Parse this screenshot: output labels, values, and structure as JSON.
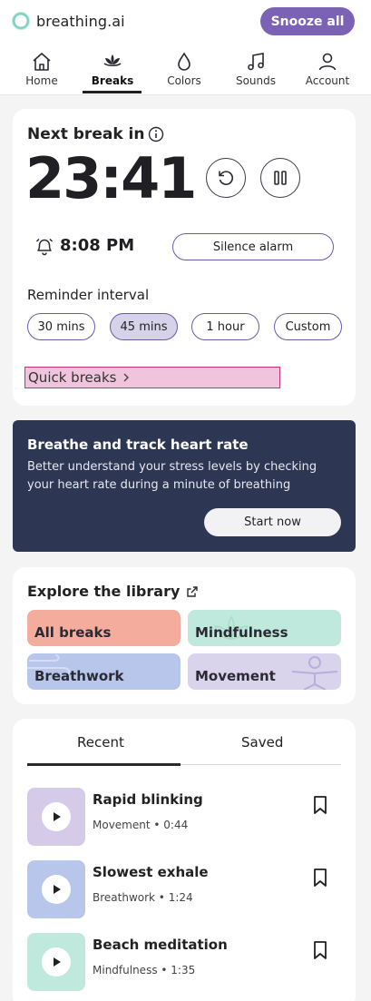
{
  "header": {
    "brand_name": "breathing.ai",
    "snooze_label": "Snooze all",
    "accent_color": "#7b62b5"
  },
  "nav": {
    "items": [
      {
        "label": "Home",
        "icon": "home-icon"
      },
      {
        "label": "Breaks",
        "icon": "lotus-icon",
        "active": true
      },
      {
        "label": "Colors",
        "icon": "drop-icon"
      },
      {
        "label": "Sounds",
        "icon": "music-note-icon"
      },
      {
        "label": "Account",
        "icon": "user-icon"
      }
    ]
  },
  "break_card": {
    "title": "Next break in",
    "timer": "23:41",
    "alarm_time": "8:08 PM",
    "silence_label": "Silence alarm",
    "interval_title": "Reminder interval",
    "intervals": [
      "30 mins",
      "45 mins",
      "1 hour",
      "Custom"
    ],
    "selected_interval": "45 mins",
    "quick_breaks_label": "Quick breaks"
  },
  "heart_card": {
    "title": "Breathe and track heart rate",
    "description": "Better understand your stress levels by checking your heart rate during a minute of breathing",
    "start_label": "Start now",
    "bg_color": "#2d3753"
  },
  "library": {
    "title": "Explore the library",
    "tiles": [
      {
        "label": "All breaks",
        "color": "#f4ad9d"
      },
      {
        "label": "Mindfulness",
        "color": "#bfe9dc"
      },
      {
        "label": "Breathwork",
        "color": "#b7c6ea"
      },
      {
        "label": "Movement",
        "color": "#d9d4ec"
      }
    ]
  },
  "recent": {
    "tabs": [
      "Recent",
      "Saved"
    ],
    "active_tab": "Recent",
    "items": [
      {
        "title": "Rapid blinking",
        "category": "Movement",
        "duration": "0:44",
        "subtitle": "Movement • 0:44",
        "color": "#d5cbe8"
      },
      {
        "title": "Slowest exhale",
        "category": "Breathwork",
        "duration": "1:24",
        "subtitle": "Breathwork • 1:24",
        "color": "#b7c6ea"
      },
      {
        "title": "Beach meditation",
        "category": "Mindfulness",
        "duration": "1:35",
        "subtitle": "Mindfulness • 1:35",
        "color": "#bfe9dc"
      }
    ]
  }
}
